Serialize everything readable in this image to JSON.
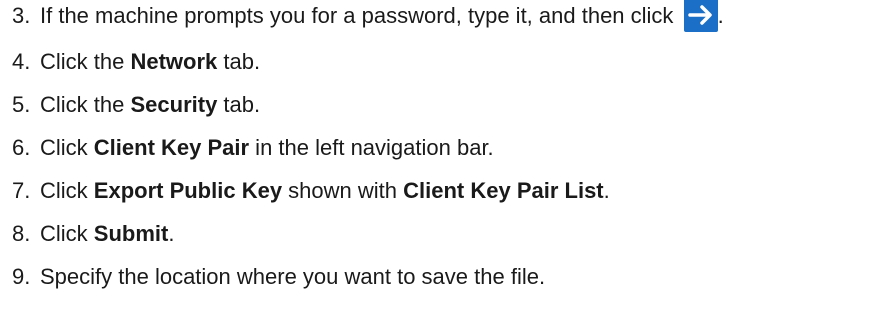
{
  "steps": [
    {
      "number": "3.",
      "before": "If the machine prompts you for a password, type it, and then click",
      "icon": "arrow-right-icon",
      "after": "."
    },
    {
      "number": "4.",
      "before": "Click the ",
      "bold": "Network",
      "after": " tab."
    },
    {
      "number": "5.",
      "before": "Click the ",
      "bold": "Security",
      "after": " tab."
    },
    {
      "number": "6.",
      "before": "Click ",
      "bold": "Client Key Pair",
      "after": " in the left navigation bar."
    },
    {
      "number": "7.",
      "before": "Click ",
      "bold": "Export Public Key",
      "middle": " shown with ",
      "bold2": "Client Key Pair List",
      "after": "."
    },
    {
      "number": "8.",
      "before": "Click ",
      "bold": "Submit",
      "after": "."
    },
    {
      "number": "9.",
      "before": "Specify the location where you want to save the file."
    }
  ],
  "colors": {
    "text": "#1a1a1a",
    "arrow_button": "#1c6fc6"
  }
}
